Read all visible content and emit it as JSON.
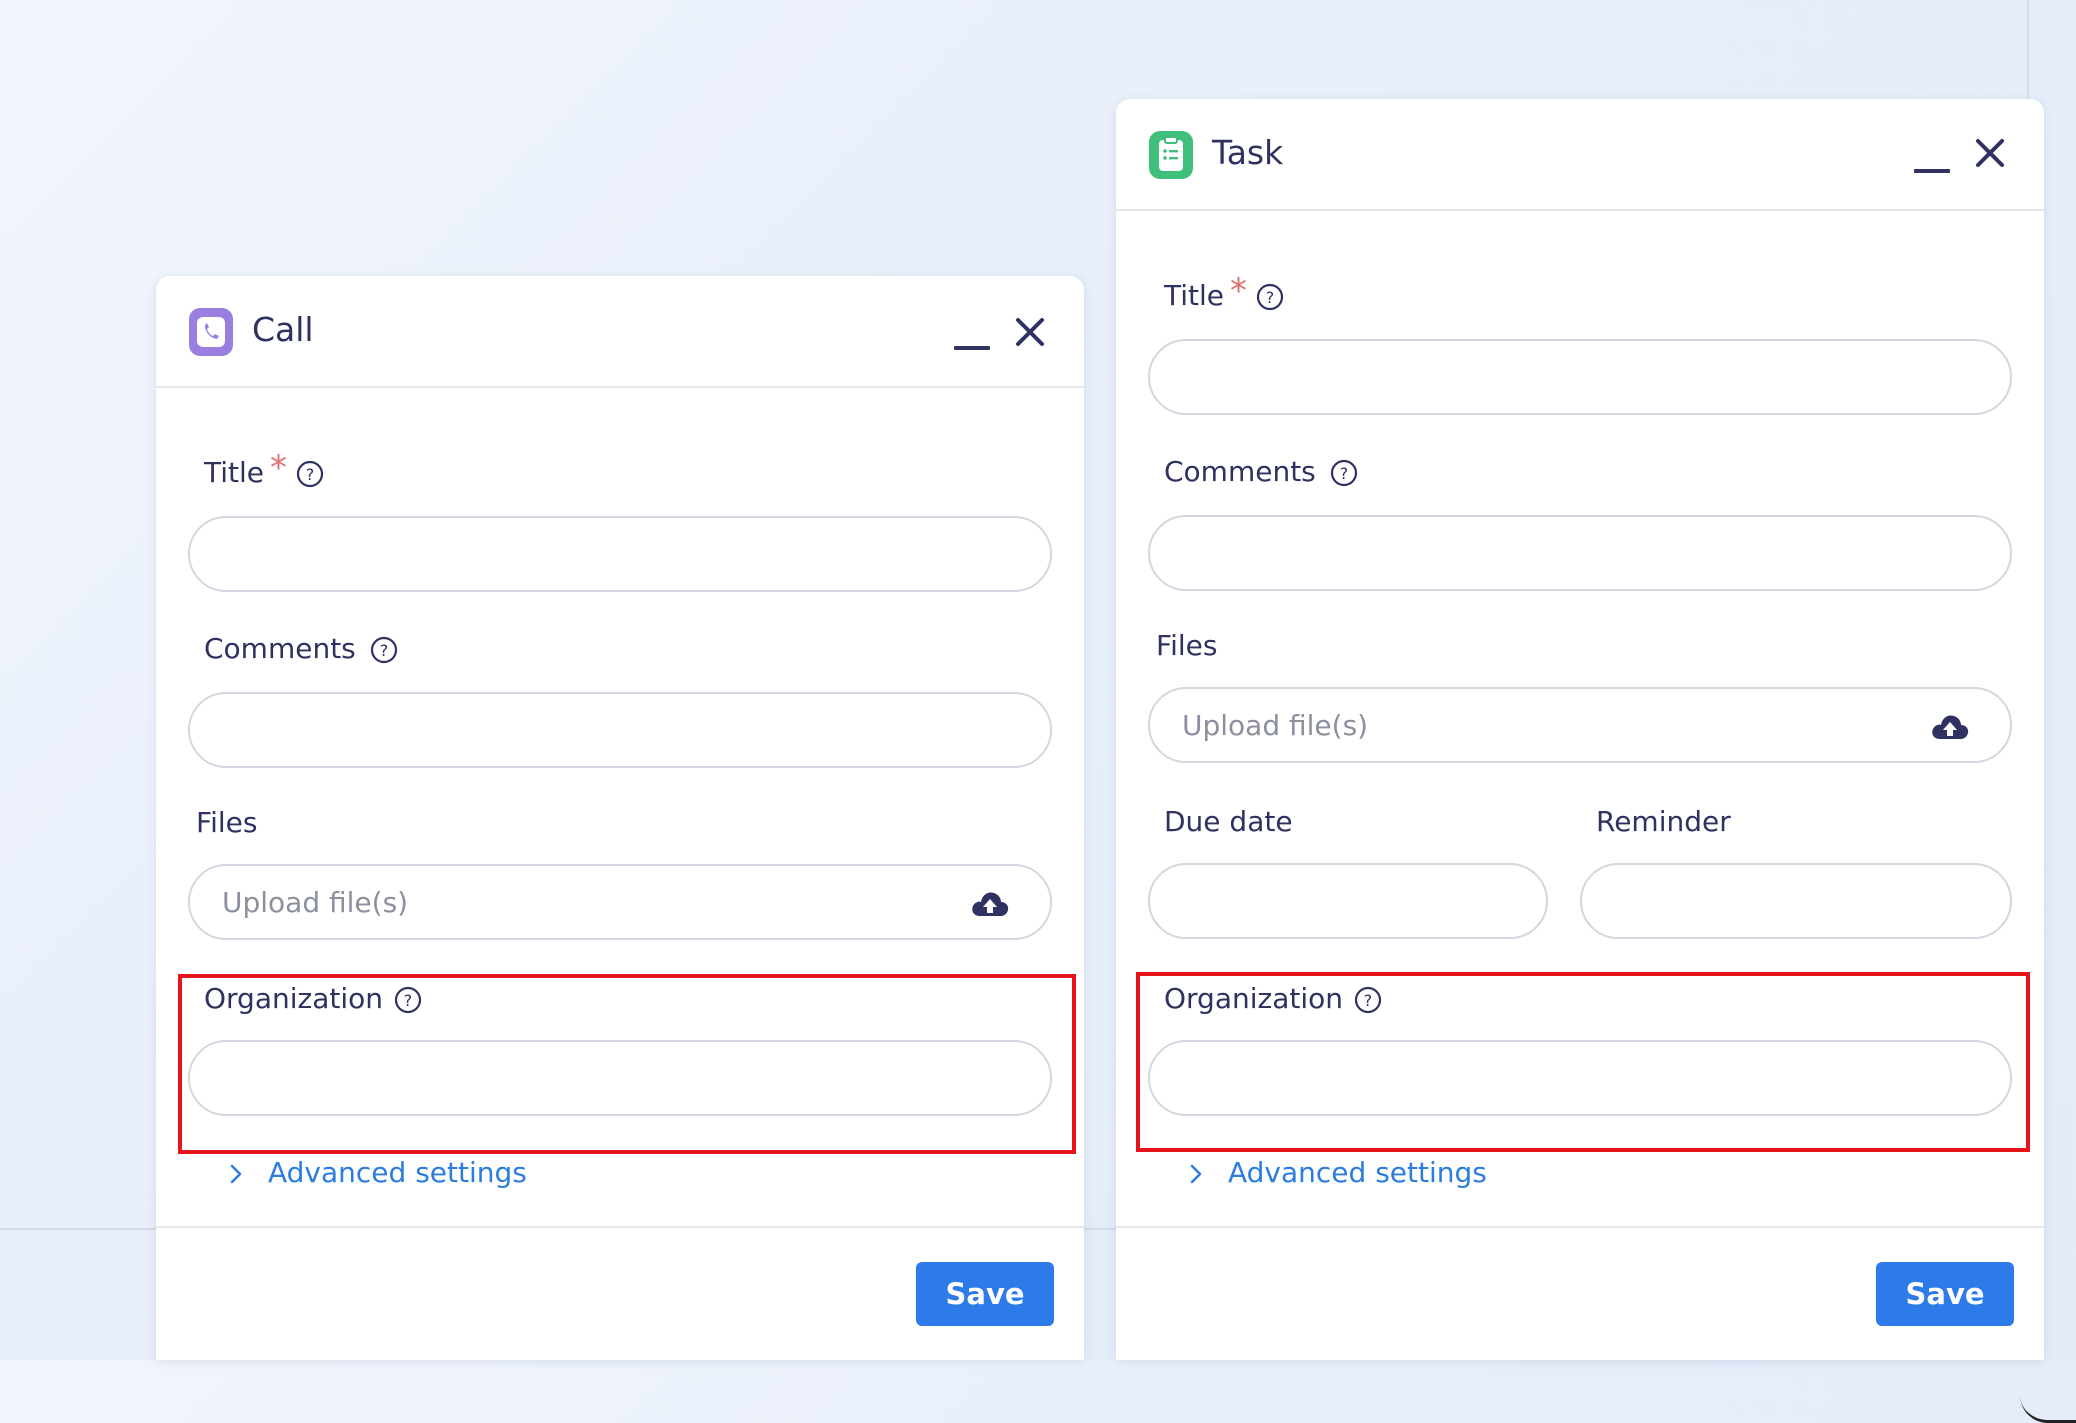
{
  "colors": {
    "accent": "#2d7be8",
    "link": "#2b7de0",
    "text": "#2f3261",
    "required": "#e07070",
    "highlight": "#e8141c",
    "call_icon": "#9b7fe0",
    "task_icon": "#3fbf7a"
  },
  "call": {
    "title": "Call",
    "icon": "phone-icon",
    "labels": {
      "title": "Title",
      "required_mark": "*",
      "comments": "Comments",
      "files": "Files",
      "organization": "Organization"
    },
    "upload_placeholder": "Upload file(s)",
    "advanced_settings": "Advanced settings",
    "save_label": "Save"
  },
  "task": {
    "title": "Task",
    "icon": "clipboard-list-icon",
    "labels": {
      "title": "Title",
      "required_mark": "*",
      "comments": "Comments",
      "files": "Files",
      "due_date": "Due date",
      "reminder": "Reminder",
      "organization": "Organization"
    },
    "upload_placeholder": "Upload file(s)",
    "advanced_settings": "Advanced settings",
    "save_label": "Save"
  }
}
